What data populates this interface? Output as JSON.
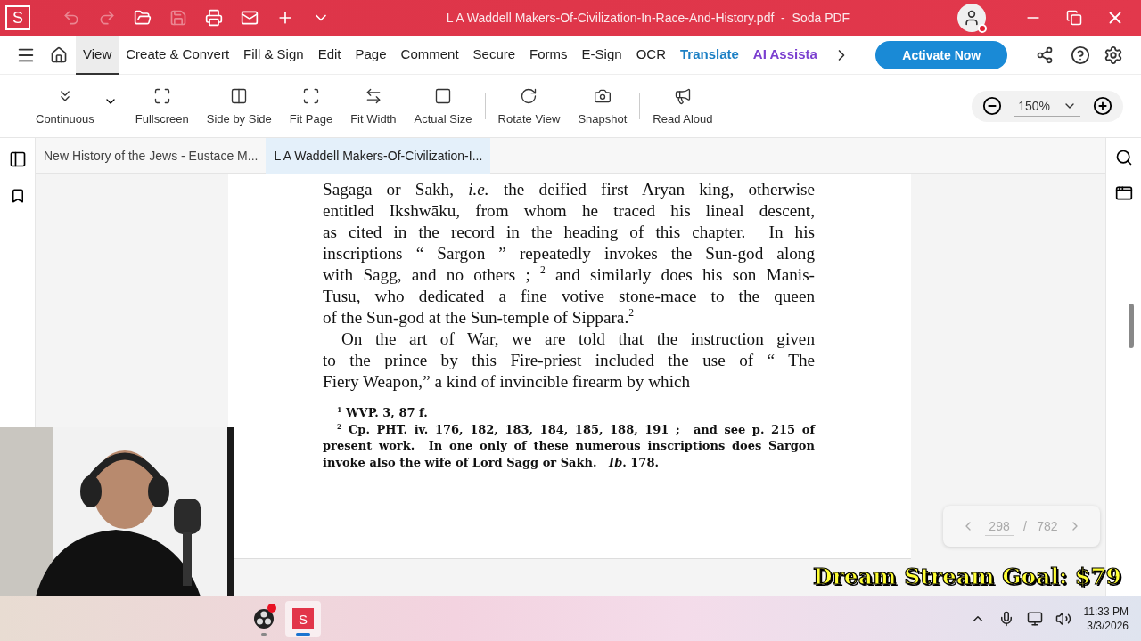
{
  "title_bar": {
    "app_logo": "S",
    "quick_actions": [
      {
        "kind": "undo",
        "disabled": true
      },
      {
        "kind": "redo",
        "disabled": true
      },
      {
        "kind": "open",
        "disabled": false
      },
      {
        "kind": "save",
        "disabled": true
      },
      {
        "kind": "print",
        "disabled": false
      },
      {
        "kind": "mail",
        "disabled": false
      },
      {
        "kind": "new",
        "disabled": false
      },
      {
        "kind": "more",
        "disabled": false
      }
    ],
    "title": "L A Waddell Makers-Of-Civilization-In-Race-And-History.pdf  -  Soda PDF",
    "notification": true
  },
  "menu": {
    "tabs": [
      {
        "label": "View",
        "selected": true,
        "color": "#202020"
      },
      {
        "label": "Create & Convert",
        "selected": false,
        "color": "#202020"
      },
      {
        "label": "Fill & Sign",
        "selected": false,
        "color": "#202020"
      },
      {
        "label": "Edit",
        "selected": false,
        "color": "#202020"
      },
      {
        "label": "Page",
        "selected": false,
        "color": "#202020"
      },
      {
        "label": "Comment",
        "selected": false,
        "color": "#202020"
      },
      {
        "label": "Secure",
        "selected": false,
        "color": "#202020"
      },
      {
        "label": "Forms",
        "selected": false,
        "color": "#202020"
      },
      {
        "label": "E-Sign",
        "selected": false,
        "color": "#202020"
      },
      {
        "label": "OCR",
        "selected": false,
        "color": "#202020"
      },
      {
        "label": "Translate",
        "selected": false,
        "color": "#1b7fc4"
      },
      {
        "label": "AI Assista",
        "selected": false,
        "color": "#7b3fd0"
      }
    ],
    "activate_button": "Activate Now"
  },
  "toolbar": {
    "tools": [
      {
        "kind": "continuous",
        "label": "Continuous",
        "dropdown": true
      },
      {
        "kind": "fullscreen",
        "label": "Fullscreen"
      },
      {
        "kind": "side_by_side",
        "label": "Side by Side"
      },
      {
        "kind": "fit_page",
        "label": "Fit Page"
      },
      {
        "kind": "fit_width",
        "label": "Fit Width"
      },
      {
        "kind": "actual_size",
        "label": "Actual Size"
      },
      {
        "kind": "rotate",
        "label": "Rotate View",
        "divider_before": true
      },
      {
        "kind": "snapshot",
        "label": "Snapshot"
      },
      {
        "kind": "read_aloud",
        "label": "Read Aloud",
        "divider_before": true
      }
    ],
    "zoom": "150%"
  },
  "document_tabs": [
    {
      "label": "New History of the Jews - Eustace M...",
      "selected": false
    },
    {
      "label": "L A Waddell Makers-Of-Civilization-I...",
      "selected": true
    }
  ],
  "page": {
    "paragraphs": [
      {
        "indent": false,
        "lines": [
          "Sagaga or Sakh, *i.e.* the deified first Aryan king, otherwise",
          "entitled Ikshwāku, from whom he traced his lineal descent,",
          "as cited in the record in the heading of this chapter.  In his",
          "inscriptions “ Sargon ” repeatedly invokes the Sun-god along",
          "with Sagg, and no others ; $^{2}$ and similarly does his son Manis-",
          "Tusu, who dedicated a fine votive stone-mace to the queen",
          "of the Sun-god at the Sun-temple of Sippara.$^{2}$"
        ]
      },
      {
        "indent": true,
        "lines": [
          "On the art of War, we are told that the instruction given",
          "to the prince by this Fire-priest included the use of “ The",
          "Fiery Weapon,” a kind of invincible firearm by which"
        ]
      }
    ],
    "footnotes": [
      {
        "lines": [
          "$^{1}$ WVP. 3, 87 f."
        ]
      },
      {
        "lines": [
          "$^{2}$ Cp. PHT. iv. 176, 182, 183, 184, 185, 188, 191 ;  and see p. 215 of",
          "present work.  In one only of these numerous inscriptions does Sargon",
          "invoke also the wife of Lord Sagg or Sakh.   *Ib*. 178."
        ]
      }
    ]
  },
  "page_nav": {
    "current": "298",
    "separator": "/",
    "total": "782"
  },
  "stream_overlay": {
    "goal": "Dream Stream Goal: $79"
  },
  "taskbar": {
    "apps": [
      {
        "kind": "obs",
        "badge": true,
        "active": false
      },
      {
        "kind": "soda",
        "label": "S",
        "badge": false,
        "active": true
      }
    ],
    "time": "11:33 PM",
    "date": "3/3/2026"
  }
}
